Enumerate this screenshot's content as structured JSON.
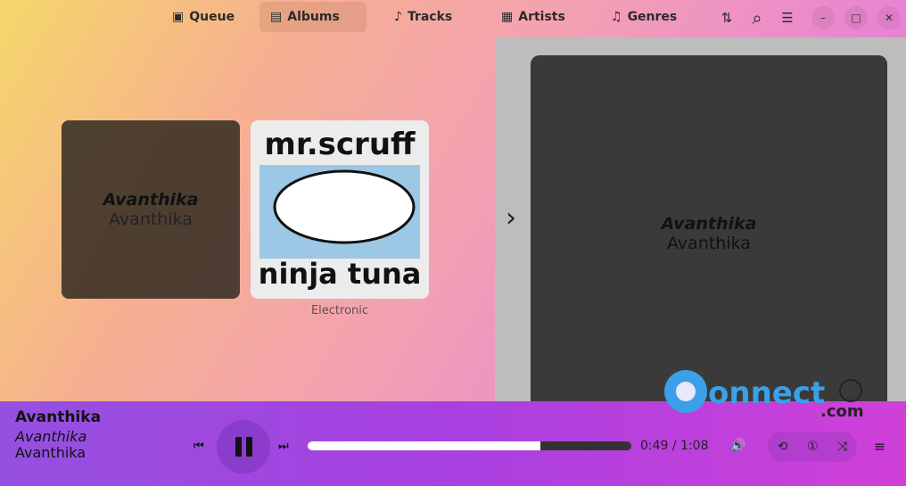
{
  "header": {
    "tabs": [
      {
        "label": "Queue",
        "icon": "queue-icon",
        "glyph": "▣"
      },
      {
        "label": "Albums",
        "icon": "album-icon",
        "glyph": "▤",
        "active": true
      },
      {
        "label": "Tracks",
        "icon": "note-icon",
        "glyph": "♪"
      },
      {
        "label": "Artists",
        "icon": "artist-icon",
        "glyph": "▦"
      },
      {
        "label": "Genres",
        "icon": "music-icon",
        "glyph": "♫"
      }
    ],
    "sort_glyph": "⇅",
    "search_glyph": "⌕",
    "menu_glyph": "☰",
    "min_glyph": "–",
    "max_glyph": "□",
    "close_glyph": "✕"
  },
  "albums": [
    {
      "title": "Avanthika",
      "artist": "Avanthika"
    },
    {
      "art_text_top": "mr.scruff",
      "art_text_bottom": "ninja tuna",
      "genre": "Electronic"
    }
  ],
  "sidebar": {
    "title": "Avanthika",
    "artist": "Avanthika",
    "chevron": "›"
  },
  "player": {
    "title": "Avanthika",
    "album": "Avanthika",
    "artist": "Avanthika",
    "prev": "⏮",
    "next": "⏭",
    "progress": 0.72,
    "elapsed": "0:49",
    "duration": "1:08",
    "time": "0:49 / 1:08",
    "volume_glyph": "🔊",
    "repeat_glyph": "⟲",
    "repeat_one_glyph": "①",
    "shuffle_glyph": "⤨",
    "queue_glyph": "≡"
  },
  "watermark": {
    "text": "connect",
    "suffix": ".com"
  },
  "colors": {
    "accent": "#a840e0",
    "progress_fill": "#ffffff"
  }
}
